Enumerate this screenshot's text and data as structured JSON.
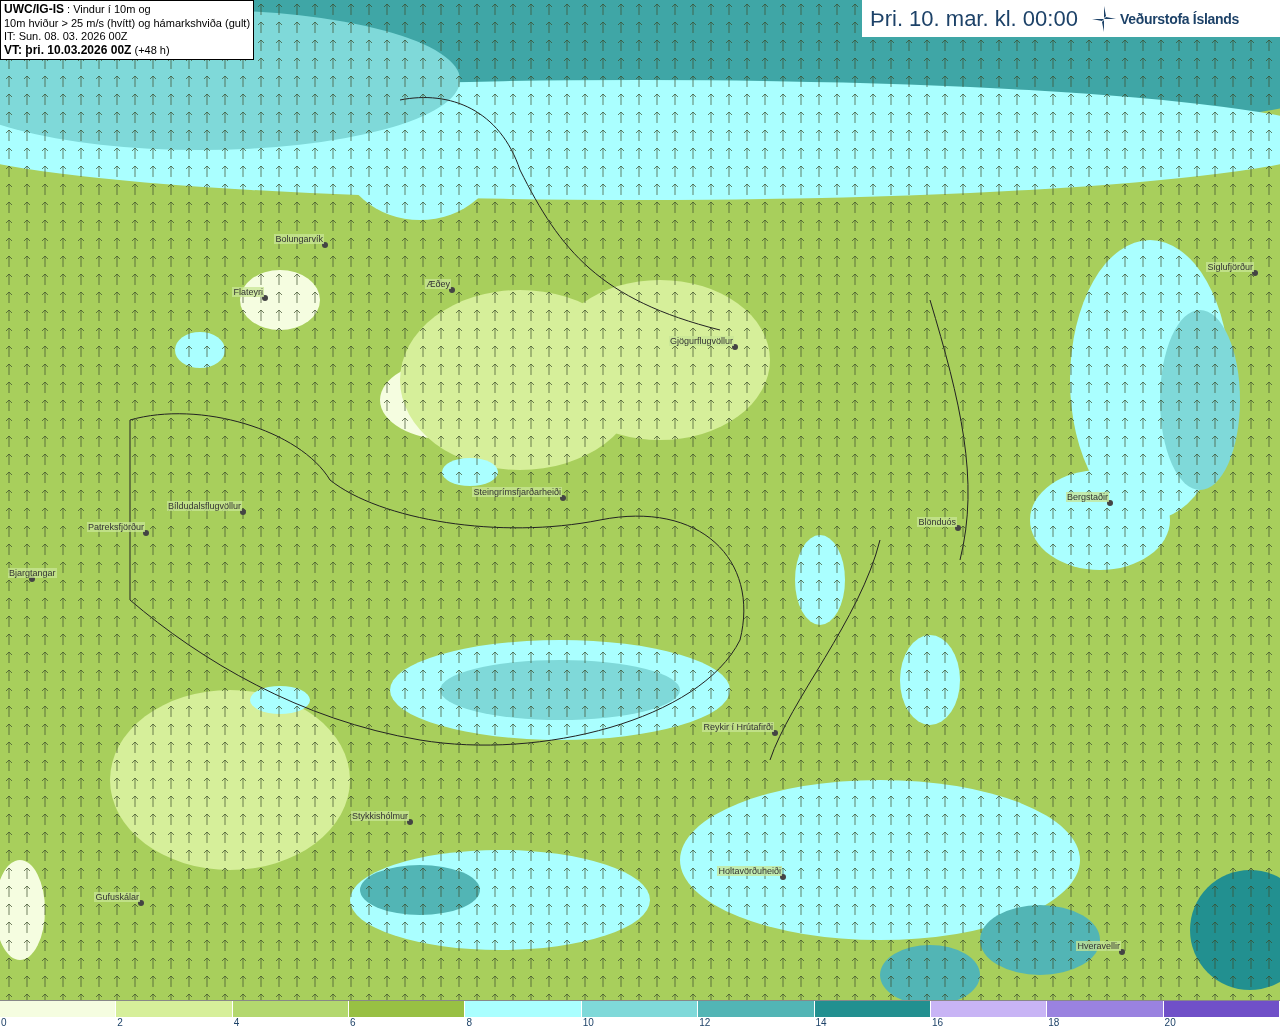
{
  "info_box": {
    "lines": [
      "**UWC/IG-IS** : Vindur í 10m og",
      "10m hviður > 25 m/s (hvítt) og hámarkshviða (gult)",
      "IT: Sun. 08. 03. 2026 00Z",
      "**VT: þri. 10.03.2026 00Z** (+48 h)"
    ]
  },
  "title_box": {
    "valid_time": "Þri. 10. mar. kl. 00:00",
    "agency": "Veðurstofa Íslands"
  },
  "places": [
    {
      "name": "Bolungarvík"
    },
    {
      "name": "Flateyri"
    },
    {
      "name": "Æðey"
    },
    {
      "name": "Gjögurflugvöllur"
    },
    {
      "name": "Siglufjörður"
    },
    {
      "name": "Steingrímsfjarðarheiði"
    },
    {
      "name": "Bíldudalsflugvöllur"
    },
    {
      "name": "Patreksfjörður"
    },
    {
      "name": "Bjargtangar"
    },
    {
      "name": "Blönduós"
    },
    {
      "name": "Bergstaðir"
    },
    {
      "name": "Reykir í Hrútafirði"
    },
    {
      "name": "Stykkishólmur"
    },
    {
      "name": "Holtavörðuheiði"
    },
    {
      "name": "Gufuskálar"
    },
    {
      "name": "Hveravellir"
    }
  ],
  "legend": {
    "segments": [
      {
        "color": "#f5fde0"
      },
      {
        "color": "#d6ef9a"
      },
      {
        "color": "#b3d86e"
      },
      {
        "color": "#98c043"
      },
      {
        "color": "#aaffff"
      },
      {
        "color": "#7fd9d9"
      },
      {
        "color": "#52b5b5"
      },
      {
        "color": "#229090"
      },
      {
        "color": "#c8b4f5"
      },
      {
        "color": "#9a82e0"
      },
      {
        "color": "#7050c8"
      }
    ],
    "ticks": [
      "0",
      "2",
      "4",
      "6",
      "8",
      "10",
      "12",
      "14",
      "16",
      "18",
      "20"
    ]
  }
}
